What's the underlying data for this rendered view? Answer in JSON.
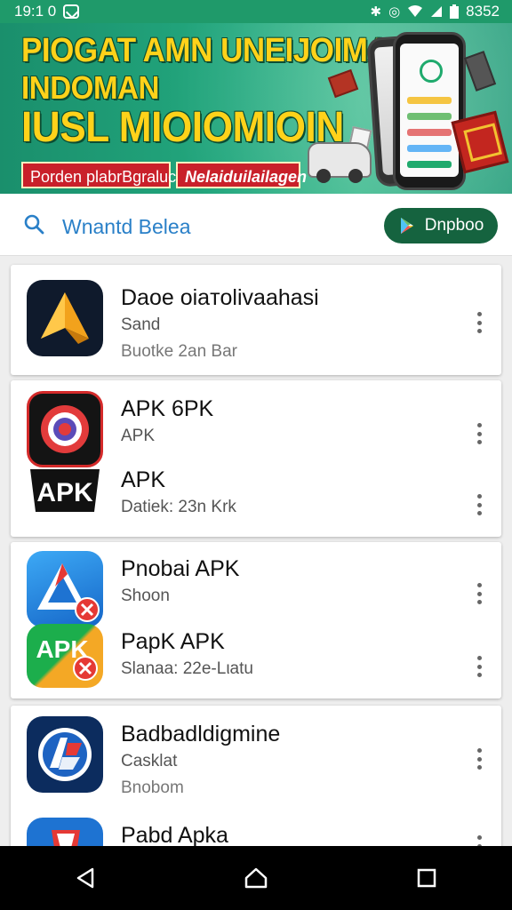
{
  "status_bar": {
    "time": "19:1 0",
    "right_text": "8352",
    "icons": [
      "bluetooth-icon",
      "alarm-icon",
      "wifi-icon",
      "signal-icon",
      "battery-icon"
    ]
  },
  "banner": {
    "line1": "PIOGAT AMN UNEIJOIMAN",
    "line2": "INDOMAN",
    "line3": "IUSL MIOIOMIOIN",
    "tag1": "Porden plabrBgraluck",
    "tag2": "Nelaiduilailagen",
    "colors": {
      "background": "#1f9a6a",
      "headline": "#ffd21a",
      "tag": "#c9202a"
    }
  },
  "search": {
    "query": "Wnantd Belea",
    "button_label": "Dnpboo"
  },
  "apps": [
    {
      "name": "Daoe oiaтolivaahasi",
      "sub1": "Sand",
      "sub2": "Buotke 2an Bar",
      "icon": "gold-arrow-icon"
    },
    {
      "name": "APK 6PK",
      "sub1": "APK",
      "sub2": "",
      "icon": "red-circle-icon"
    },
    {
      "name": "APK",
      "sub1": "",
      "sub2": "Datiek: 23n Krk",
      "icon": "apk-text-icon"
    },
    {
      "name": "Pnobai APK",
      "sub1": "Shoon",
      "sub2": "",
      "icon": "blue-triangle-icon"
    },
    {
      "name": "PapK APK",
      "sub1": "",
      "sub2": "Slanaa: 22e-Lιatu",
      "icon": "green-apk-icon"
    },
    {
      "name": "Badbadldigmine",
      "sub1": "Casklat",
      "sub2": "Bnobom",
      "icon": "blue-badge-icon"
    },
    {
      "name": "Pabd Apka",
      "sub1": "",
      "sub2": "",
      "icon": "blue-shield-icon"
    }
  ],
  "nav": {
    "icons": [
      "back-icon",
      "home-icon",
      "recents-icon"
    ]
  }
}
